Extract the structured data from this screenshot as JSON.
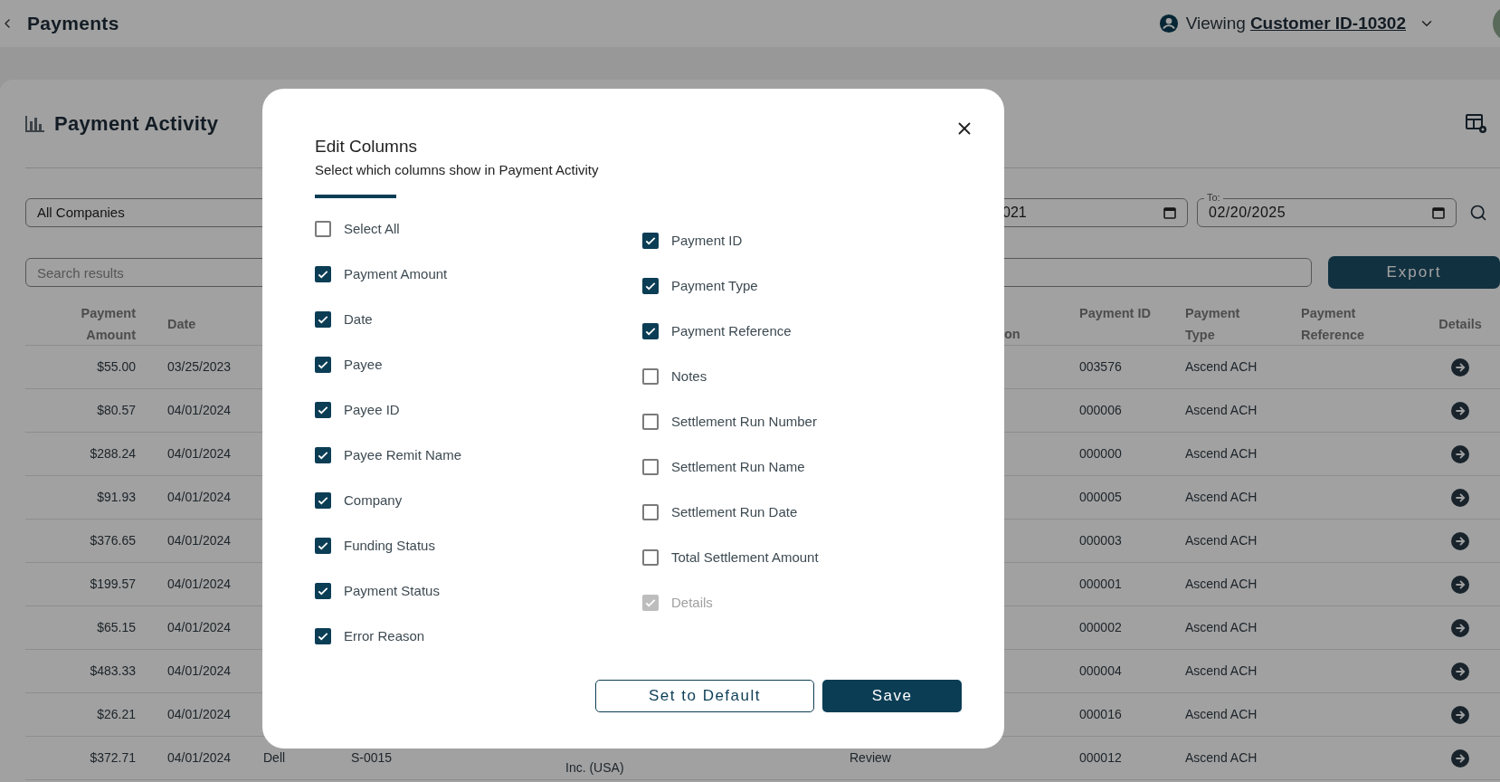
{
  "header": {
    "title": "Payments",
    "viewing_label": "Viewing",
    "customer": "Customer ID-10302"
  },
  "activity": {
    "title": "Payment Activity",
    "company_filter": "All Companies",
    "from_date": "021",
    "to_label": "To:",
    "to_date": "02/20/2025",
    "search_placeholder": "Search results",
    "export": "Export"
  },
  "table": {
    "columns": {
      "amount": "Payment Amount",
      "date": "Date",
      "column_7": "on",
      "payment_id": "Payment ID",
      "payment_type": "Payment Type",
      "payment_reference": "Payment Reference",
      "details": "Details"
    },
    "rows": [
      {
        "amount": "$55.00",
        "date": "03/25/2023",
        "payment_id": "003576",
        "payment_type": "Ascend ACH"
      },
      {
        "amount": "$80.57",
        "date": "04/01/2024",
        "payment_id": "000006",
        "payment_type": "Ascend ACH"
      },
      {
        "amount": "$288.24",
        "date": "04/01/2024",
        "payment_id": "000000",
        "payment_type": "Ascend ACH"
      },
      {
        "amount": "$91.93",
        "date": "04/01/2024",
        "payment_id": "000005",
        "payment_type": "Ascend ACH"
      },
      {
        "amount": "$376.65",
        "date": "04/01/2024",
        "payment_id": "000003",
        "payment_type": "Ascend ACH"
      },
      {
        "amount": "$199.57",
        "date": "04/01/2024",
        "payment_id": "000001",
        "payment_type": "Ascend ACH"
      },
      {
        "amount": "$65.15",
        "date": "04/01/2024",
        "payment_id": "000002",
        "payment_type": "Ascend ACH"
      },
      {
        "amount": "$483.33",
        "date": "04/01/2024",
        "payment_id": "000004",
        "payment_type": "Ascend ACH"
      },
      {
        "amount": "$26.21",
        "date": "04/01/2024",
        "payment_id": "000016",
        "payment_type": "Ascend ACH"
      },
      {
        "amount": "$372.71",
        "date": "04/01/2024",
        "column_3": "Dell",
        "column_4": "S-0015",
        "column_5": "Inc. (USA)",
        "column_6": "Review",
        "payment_id": "000012",
        "payment_type": "Ascend ACH"
      }
    ]
  },
  "modal": {
    "title": "Edit Columns",
    "subtitle": "Select which columns show in Payment Activity",
    "left_items": [
      {
        "label": "Select All",
        "checked": false,
        "disabled": false
      },
      {
        "label": "Payment Amount",
        "checked": true,
        "disabled": false
      },
      {
        "label": "Date",
        "checked": true,
        "disabled": false
      },
      {
        "label": "Payee",
        "checked": true,
        "disabled": false
      },
      {
        "label": "Payee ID",
        "checked": true,
        "disabled": false
      },
      {
        "label": "Payee Remit Name",
        "checked": true,
        "disabled": false
      },
      {
        "label": "Company",
        "checked": true,
        "disabled": false
      },
      {
        "label": "Funding Status",
        "checked": true,
        "disabled": false
      },
      {
        "label": "Payment Status",
        "checked": true,
        "disabled": false
      },
      {
        "label": "Error Reason",
        "checked": true,
        "disabled": false
      }
    ],
    "right_items": [
      {
        "label": "Payment ID",
        "checked": true,
        "disabled": false
      },
      {
        "label": "Payment Type",
        "checked": true,
        "disabled": false
      },
      {
        "label": "Payment Reference",
        "checked": true,
        "disabled": false
      },
      {
        "label": "Notes",
        "checked": false,
        "disabled": false
      },
      {
        "label": "Settlement Run Number",
        "checked": false,
        "disabled": false
      },
      {
        "label": "Settlement Run Name",
        "checked": false,
        "disabled": false
      },
      {
        "label": "Settlement Run Date",
        "checked": false,
        "disabled": false
      },
      {
        "label": "Total Settlement Amount",
        "checked": false,
        "disabled": false
      },
      {
        "label": "Details",
        "checked": true,
        "disabled": true
      }
    ],
    "buttons": {
      "secondary": "Set to Default",
      "primary": "Save"
    }
  }
}
